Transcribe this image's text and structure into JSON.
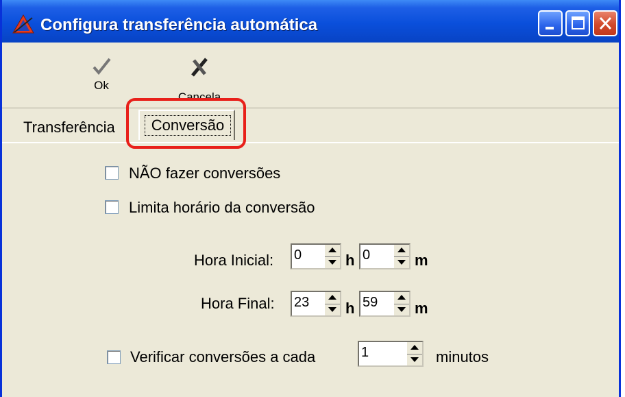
{
  "window": {
    "title": "Configura transferência automática"
  },
  "toolbar": {
    "ok_label": "Ok",
    "cancel_label": "Cancela"
  },
  "tabs": [
    {
      "label": "Transferência"
    },
    {
      "label": "Conversão"
    }
  ],
  "options": {
    "no_conversions": {
      "label": "NÃO fazer conversões",
      "checked": false
    },
    "limit_schedule": {
      "label": "Limita horário da conversão",
      "checked": false
    },
    "start": {
      "label": "Hora Inicial:",
      "hour": "0",
      "minute": "0"
    },
    "end": {
      "label": "Hora Final:",
      "hour": "23",
      "minute": "59"
    },
    "units": {
      "h": "h",
      "m": "m"
    },
    "verify": {
      "label": "Verificar conversões a cada",
      "value": "1",
      "unit": "minutos",
      "checked": false
    }
  },
  "colors": {
    "title_bar": "#0A4FDB",
    "highlight": "#E8201A",
    "panel": "#ECE9D8"
  }
}
